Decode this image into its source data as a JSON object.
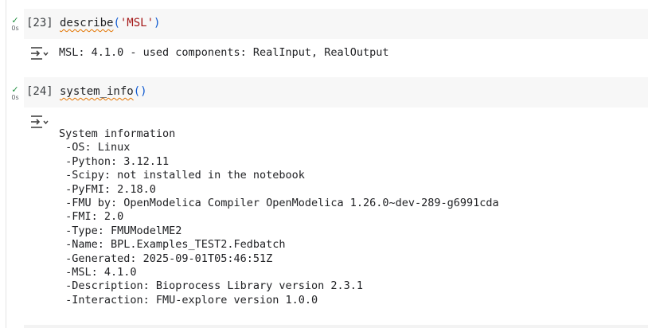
{
  "cells": [
    {
      "status_icon": "check-icon",
      "time": "0s",
      "prompt": "[23]",
      "code": {
        "fn": "describe",
        "open": "(",
        "arg": "'MSL'",
        "close": ")"
      },
      "output_icon": "output-toggle-icon",
      "output": "MSL: 4.1.0 - used components: RealInput, RealOutput"
    },
    {
      "status_icon": "check-icon",
      "time": "0s",
      "prompt": "[24]",
      "code": {
        "fn": "system_info",
        "open": "(",
        "arg": "",
        "close": ")"
      },
      "output_icon": "output-toggle-icon",
      "output": "System information\n -OS: Linux\n -Python: 3.12.11\n -Scipy: not installed in the notebook\n -PyFMI: 2.18.0\n -FMU by: OpenModelica Compiler OpenModelica 1.26.0~dev-289-g6991cda\n -FMI: 2.0\n -Type: FMUModelME2\n -Name: BPL.Examples_TEST2.Fedbatch\n -Generated: 2025-09-01T05:46:51Z\n -MSL: 4.1.0\n -Description: Bioprocess Library version 2.3.1\n -Interaction: FMU-explore version 1.0.0"
    }
  ],
  "colors": {
    "success": "#1e8e3e",
    "code_bg": "#f7f7f7",
    "string": "#a31515",
    "paren": "#0b57d0"
  }
}
